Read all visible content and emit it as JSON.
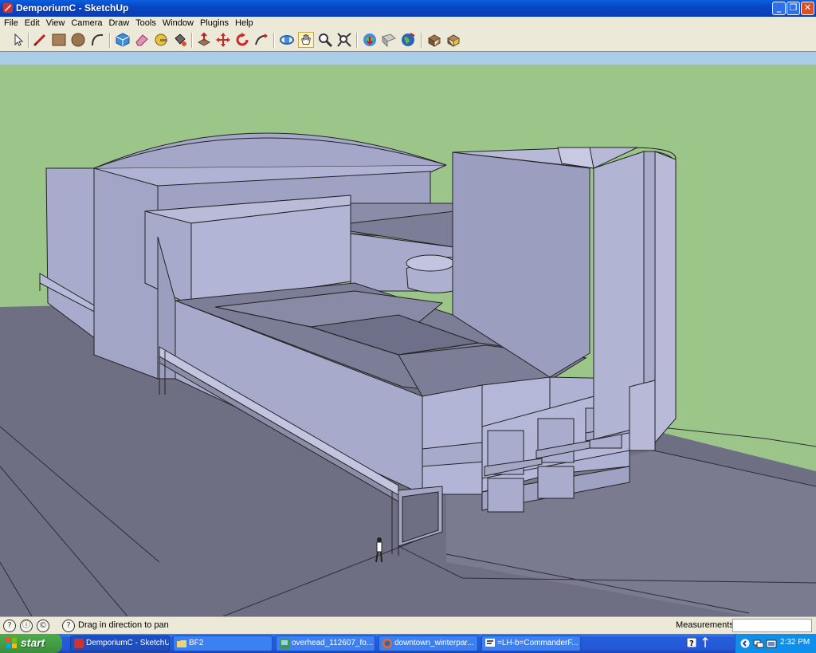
{
  "window": {
    "title": "DemporiumC - SketchUp"
  },
  "menu": [
    "File",
    "Edit",
    "View",
    "Camera",
    "Draw",
    "Tools",
    "Window",
    "Plugins",
    "Help"
  ],
  "toolbar": {
    "tools": [
      "select-tool",
      "line-tool",
      "rectangle-tool",
      "circle-tool",
      "arc-tool",
      "make-component-tool",
      "eraser-tool",
      "tape-measure-tool",
      "paint-bucket-tool",
      "push-pull-tool",
      "move-tool",
      "rotate-tool",
      "follow-me-tool",
      "orbit-tool",
      "pan-tool",
      "zoom-tool",
      "zoom-extents-tool",
      "get-models-tool",
      "share-model-tool",
      "google-earth-tool",
      "component-1-tool",
      "component-2-tool"
    ]
  },
  "statusbar": {
    "message": "Drag in direction to pan",
    "measurements_label": "Measurements",
    "measurements_value": ""
  },
  "taskbar": {
    "start_label": "start",
    "tasks": [
      {
        "label": "DemporiumC - SketchUp",
        "active": true
      },
      {
        "label": "BF2",
        "active": false
      },
      {
        "label": "overhead_112607_fo...",
        "active": false
      },
      {
        "label": "downtown_winterpar...",
        "active": false
      },
      {
        "label": "=LH-b=CommanderF...",
        "active": false
      }
    ],
    "clock": "2:32 PM"
  },
  "colors": {
    "sky": "#aacde8",
    "grass": "#9cc58a",
    "ground": "#6e6f82",
    "face_light": "#b3b5d6",
    "face_mid": "#a0a2c4",
    "face_dark": "#8b8da8",
    "roof": "#7c7e98"
  }
}
